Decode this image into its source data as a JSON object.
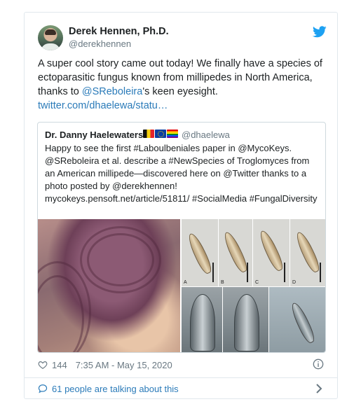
{
  "author": {
    "name": "Derek Hennen, Ph.D.",
    "handle": "@derekhennen"
  },
  "tweet": {
    "text_before": "A super cool story came out today! We finally have a species of ectoparasitic fungus known from millipedes in North America, thanks to ",
    "mention": "@SReboleira",
    "text_after": "'s keen eyesight.",
    "link": "twitter.com/dhaelewa/statu…"
  },
  "quote": {
    "name": "Dr. Danny Haelewaters",
    "handle": "@dhaelewa",
    "text": "Happy to see the first #Laboulbeniales paper in @MycoKeys. @SReboleira et al. describe a #NewSpecies of Troglomyces from an American millipede—discovered here on @Twitter thanks to a photo posted by @derekhennen! mycokeys.pensoft.net/article/51811/ #SocialMedia #FungalDiversity",
    "flags": [
      "belgium-flag",
      "eu-flag",
      "rainbow-flag"
    ],
    "media_panel_letters": [
      "A",
      "B",
      "C",
      "D"
    ]
  },
  "footer": {
    "likes": "144",
    "timestamp": "7:35 AM - May 15, 2020",
    "talking": "61 people are talking about this"
  },
  "colors": {
    "link": "#2b7bb9",
    "muted": "#697882",
    "twitter_blue": "#1da1f2"
  }
}
